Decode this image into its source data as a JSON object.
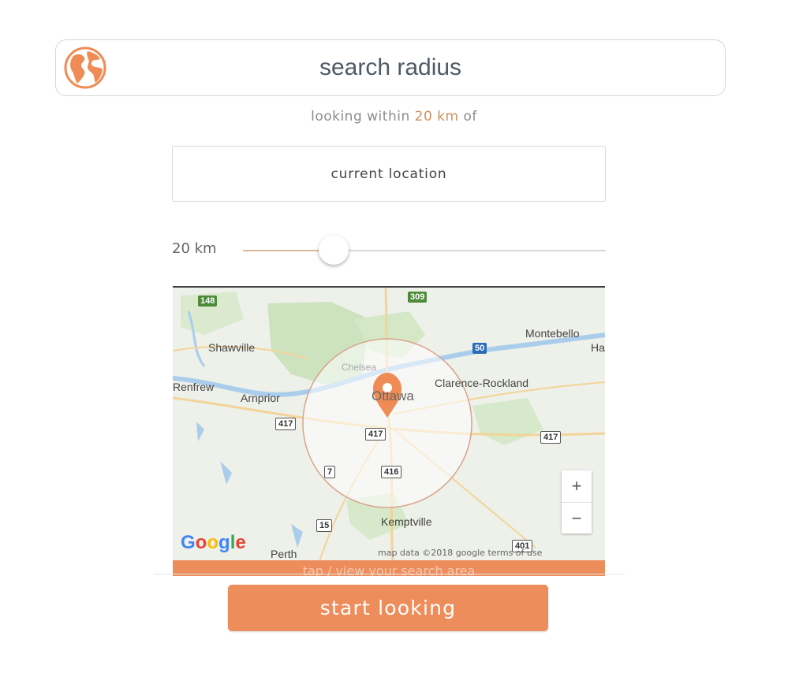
{
  "header": {
    "title": "search radius",
    "icon": "globe-icon",
    "accent": "#ef8b55"
  },
  "subtitle": {
    "prefix": "looking within",
    "value": "20 km",
    "suffix": "of"
  },
  "location_button": {
    "label": "current location"
  },
  "slider": {
    "label": "20 km",
    "value_fraction": 0.25
  },
  "map": {
    "places": {
      "shawville": "Shawville",
      "renfrew": "Renfrew",
      "arnprior": "Arnprior",
      "chelsea": "Chelsea",
      "ottawa": "Ottawa",
      "montebello": "Montebello",
      "clarence_rockland": "Clarence-Rockland",
      "kemptville": "Kemptville",
      "perth": "Perth",
      "ha": "Ha"
    },
    "highways": {
      "h148": "148",
      "h309": "309",
      "h50": "50",
      "h417a": "417",
      "h417b": "417",
      "h417c": "417",
      "h7": "7",
      "h416": "416",
      "h15": "15",
      "h401": "401"
    },
    "zoom_in": "+",
    "zoom_out": "−",
    "google": [
      "G",
      "o",
      "o",
      "g",
      "l",
      "e"
    ],
    "attribution": "map data ©2018 google   terms of use",
    "bar_text": "tap / view your search area",
    "pin_color": "#ef8b55"
  },
  "start_button": {
    "label": "start looking",
    "color": "#ee8d5c"
  }
}
